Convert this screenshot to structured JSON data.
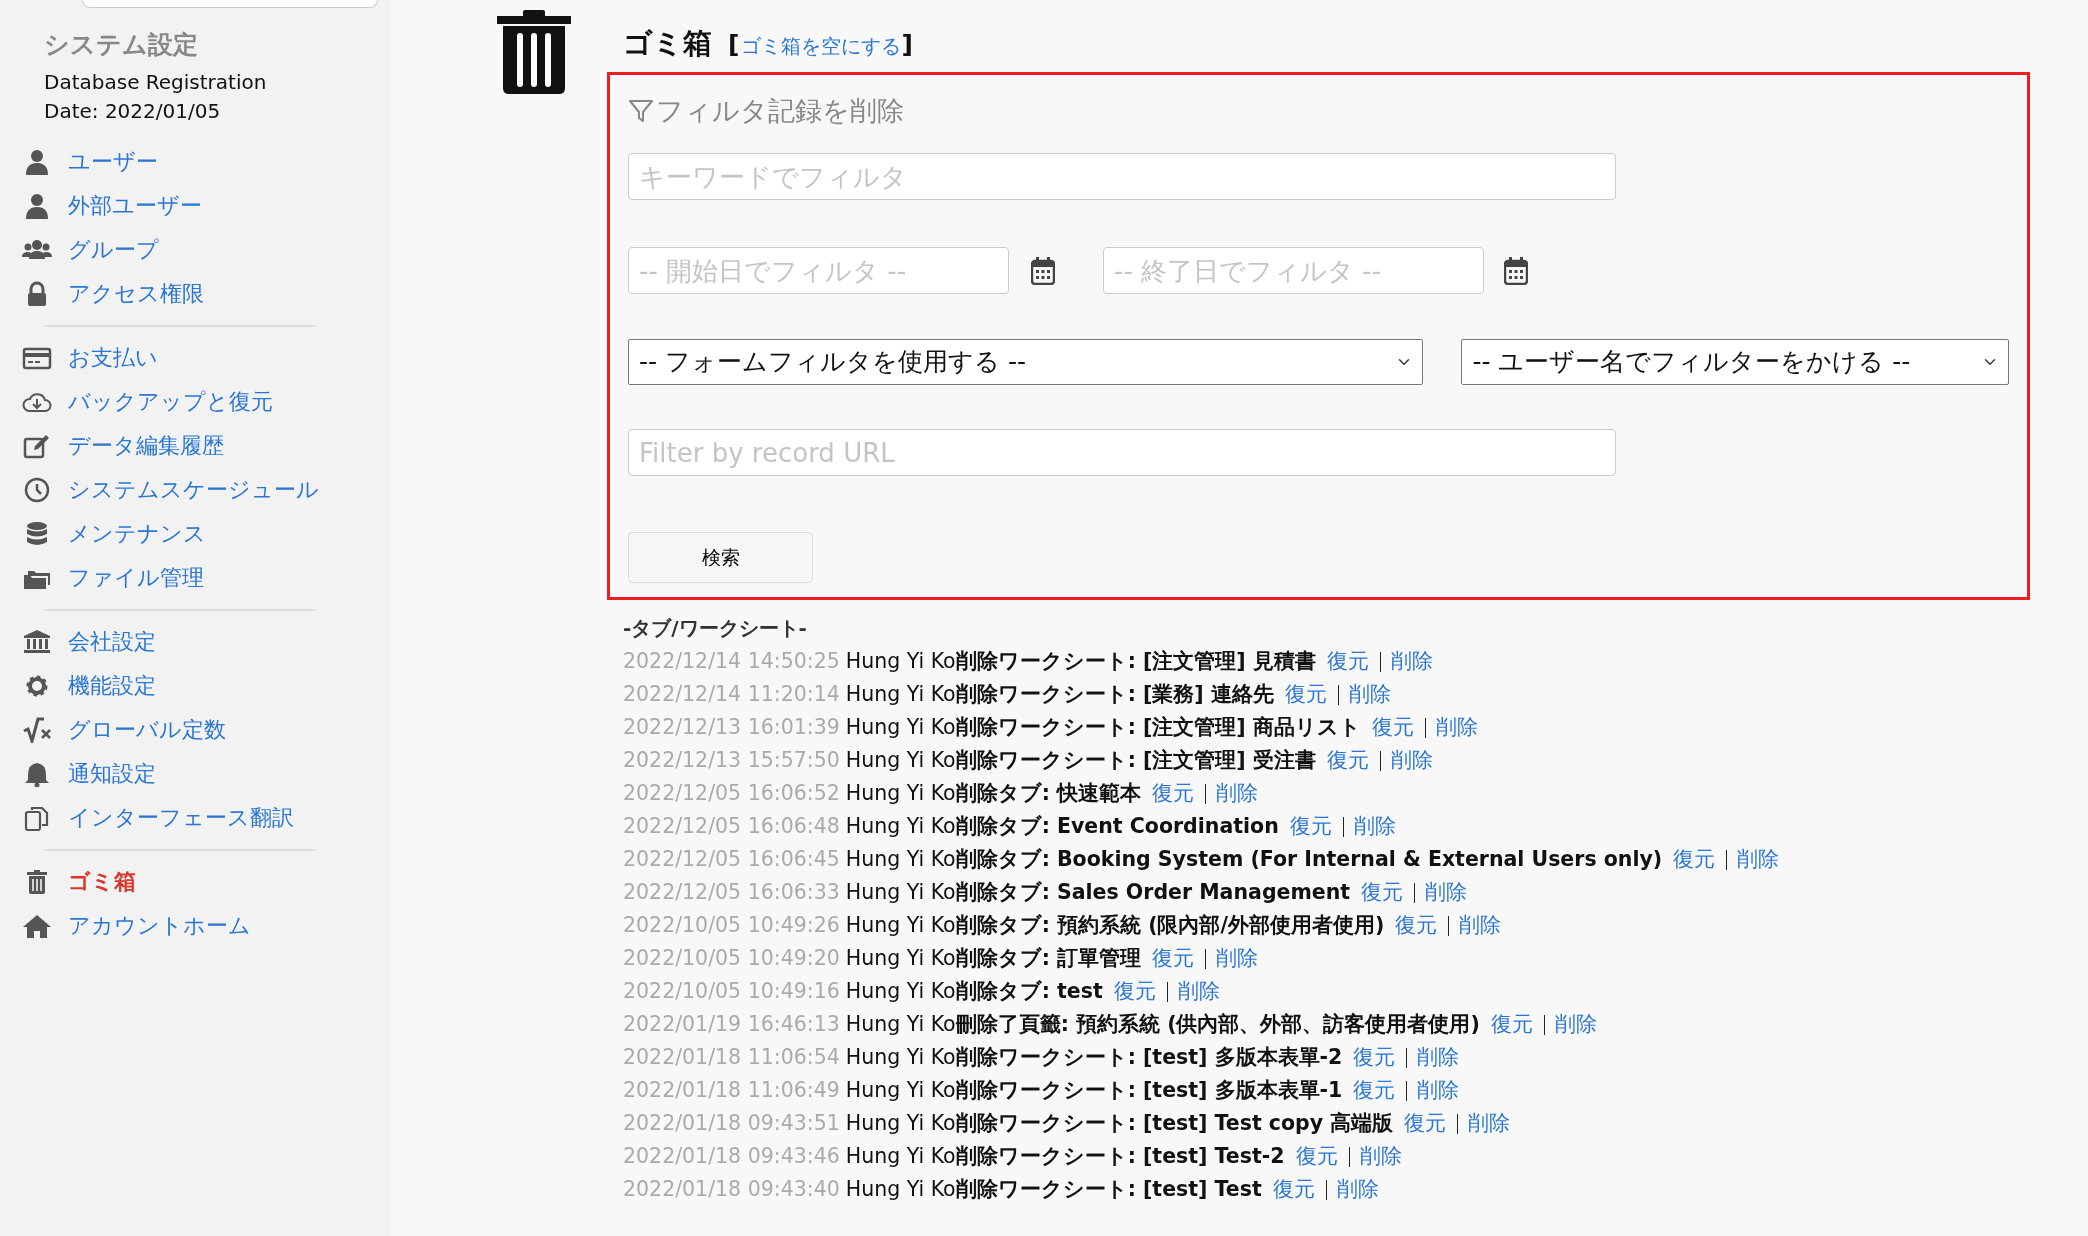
{
  "sidebar": {
    "title": "システム設定",
    "registration": [
      "Database Registration",
      "Date: 2022/01/05"
    ],
    "groups": [
      [
        {
          "label": "ユーザー",
          "selected": false
        },
        {
          "label": "外部ユーザー",
          "selected": false
        },
        {
          "label": "グループ",
          "selected": false
        },
        {
          "label": "アクセス権限",
          "selected": false
        }
      ],
      [
        {
          "label": "お支払い",
          "selected": false
        },
        {
          "label": "バックアップと復元",
          "selected": false
        },
        {
          "label": "データ編集履歴",
          "selected": false
        },
        {
          "label": "システムスケージュール",
          "selected": false
        },
        {
          "label": "メンテナンス",
          "selected": false
        },
        {
          "label": "ファイル管理",
          "selected": false
        }
      ],
      [
        {
          "label": "会社設定",
          "selected": false
        },
        {
          "label": "機能設定",
          "selected": false
        },
        {
          "label": "グローバル定数",
          "selected": false
        },
        {
          "label": "通知設定",
          "selected": false
        },
        {
          "label": "インターフェース翻訳",
          "selected": false
        }
      ],
      [
        {
          "label": "ゴミ箱",
          "selected": true
        },
        {
          "label": "アカウントホーム",
          "selected": false
        }
      ]
    ]
  },
  "page": {
    "title": "ゴミ箱",
    "open_bracket": "[",
    "empty_link": "ゴミ箱を空にする",
    "close_bracket": "]"
  },
  "filter": {
    "title": "フィルタ記録を削除",
    "keyword": {
      "placeholder": "キーワードでフィルタ"
    },
    "start_date": {
      "placeholder": "-- 開始日でフィルタ --"
    },
    "end_date": {
      "placeholder": "-- 終了日でフィルタ --"
    },
    "form_filter": {
      "value": "-- フォームフィルタを使用する --"
    },
    "user_filter": {
      "value": "-- ユーザー名でフィルターをかける --"
    },
    "url": {
      "placeholder": "Filter by record URL"
    },
    "search_button": "検索"
  },
  "log": {
    "heading": "-タブ/ワークシート-",
    "entries": [
      {
        "time": "2022/12/14 14:50:25",
        "text": "Hung Yi Ko**削除ワークシート: [注文管理] 見積書**",
        "restore": "復元",
        "delete": "削除"
      },
      {
        "time": "2022/12/14 11:20:14",
        "text": "Hung Yi Ko**削除ワークシート: [業務] 連絡先**",
        "restore": "復元",
        "delete": "削除"
      },
      {
        "time": "2022/12/13 16:01:39",
        "text": "Hung Yi Ko**削除ワークシート: [注文管理] 商品リスト**",
        "restore": "復元",
        "delete": "削除"
      },
      {
        "time": "2022/12/13 15:57:50",
        "text": "Hung Yi Ko**削除ワークシート: [注文管理] 受注書**",
        "restore": "復元",
        "delete": "削除"
      },
      {
        "time": "2022/12/05 16:06:52",
        "text": "Hung Yi Ko**削除タブ: 快速範本**",
        "restore": "復元",
        "delete": "削除"
      },
      {
        "time": "2022/12/05 16:06:48",
        "text": "Hung Yi Ko**削除タブ: Event Coordination**",
        "restore": "復元",
        "delete": "削除"
      },
      {
        "time": "2022/12/05 16:06:45",
        "text": "Hung Yi Ko**削除タブ: Booking System (For Internal & External Users only)**",
        "restore": "復元",
        "delete": "削除"
      },
      {
        "time": "2022/12/05 16:06:33",
        "text": "Hung Yi Ko**削除タブ: Sales Order Management**",
        "restore": "復元",
        "delete": "削除"
      },
      {
        "time": "2022/10/05 10:49:26",
        "text": "Hung Yi Ko**削除タブ: 預約系統 (限內部/外部使用者使用)**",
        "restore": "復元",
        "delete": "削除"
      },
      {
        "time": "2022/10/05 10:49:20",
        "text": "Hung Yi Ko**削除タブ: 訂單管理**",
        "restore": "復元",
        "delete": "削除"
      },
      {
        "time": "2022/10/05 10:49:16",
        "text": "Hung Yi Ko**削除タブ: test**",
        "restore": "復元",
        "delete": "削除"
      },
      {
        "time": "2022/01/19 16:46:13",
        "text": "Hung Yi Ko**刪除了頁籤: 預約系統 (供內部、外部、訪客使用者使用)**",
        "restore": "復元",
        "delete": "削除"
      },
      {
        "time": "2022/01/18 11:06:54",
        "text": "Hung Yi Ko**削除ワークシート: [test] 多版本表單-2**",
        "restore": "復元",
        "delete": "削除"
      },
      {
        "time": "2022/01/18 11:06:49",
        "text": "Hung Yi Ko**削除ワークシート: [test] 多版本表單-1**",
        "restore": "復元",
        "delete": "削除"
      },
      {
        "time": "2022/01/18 09:43:51",
        "text": "Hung Yi Ko**削除ワークシート: [test] Test copy 高端版**",
        "restore": "復元",
        "delete": "削除"
      },
      {
        "time": "2022/01/18 09:43:46",
        "text": "Hung Yi Ko**削除ワークシート: [test] Test-2**",
        "restore": "復元",
        "delete": "削除"
      },
      {
        "time": "2022/01/18 09:43:40",
        "text": "Hung Yi Ko**削除ワークシート: [test] Test**",
        "restore": "復元",
        "delete": "削除"
      }
    ]
  }
}
